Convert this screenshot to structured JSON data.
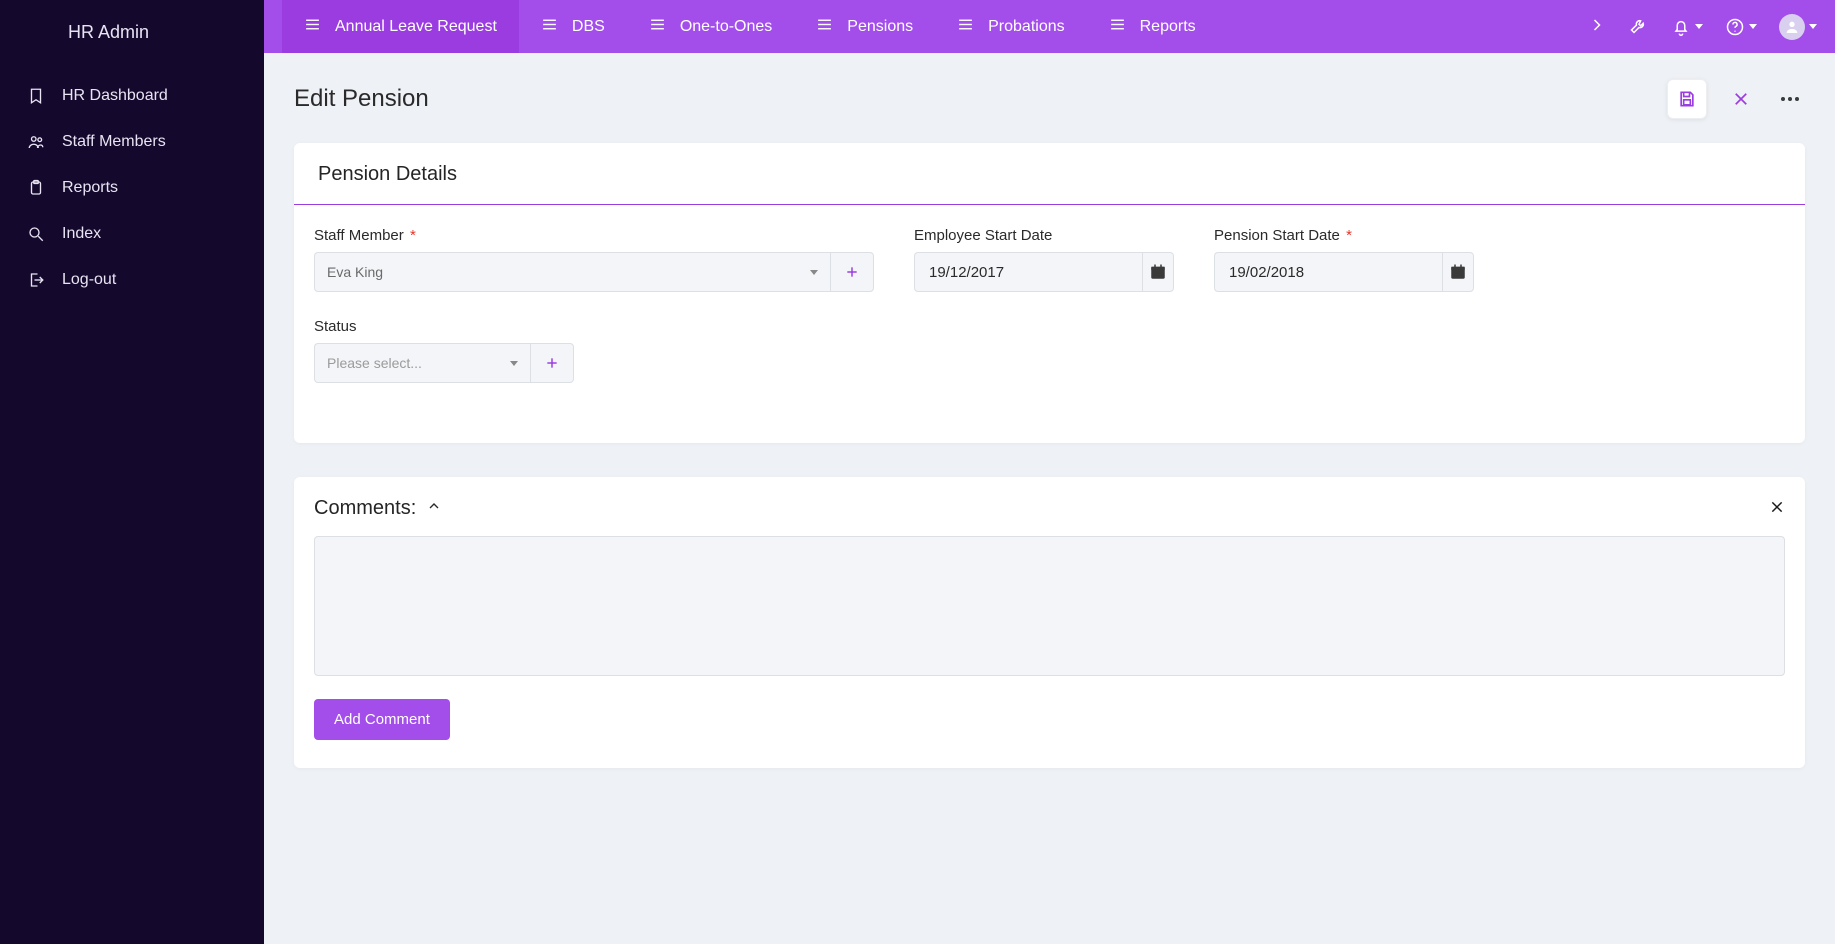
{
  "app": {
    "title": "HR Admin"
  },
  "sidebar": {
    "items": [
      {
        "label": "HR Dashboard",
        "icon": "bookmark-icon"
      },
      {
        "label": "Staff Members",
        "icon": "people-icon"
      },
      {
        "label": "Reports",
        "icon": "clipboard-icon"
      },
      {
        "label": "Index",
        "icon": "search-icon"
      },
      {
        "label": "Log-out",
        "icon": "logout-icon"
      }
    ]
  },
  "topTabs": [
    {
      "label": "Annual Leave Request"
    },
    {
      "label": "DBS"
    },
    {
      "label": "One-to-Ones"
    },
    {
      "label": "Pensions"
    },
    {
      "label": "Probations"
    },
    {
      "label": "Reports"
    }
  ],
  "page": {
    "title": "Edit Pension",
    "card_title": "Pension Details",
    "fields": {
      "staff_member": {
        "label": "Staff Member",
        "value": "Eva King",
        "required": true
      },
      "employee_start_date": {
        "label": "Employee Start Date",
        "value": "19/12/2017",
        "required": false
      },
      "pension_start_date": {
        "label": "Pension Start Date",
        "value": "19/02/2018",
        "required": true
      },
      "status": {
        "label": "Status",
        "placeholder": "Please select...",
        "required": false
      }
    }
  },
  "comments": {
    "title": "Comments:",
    "add_label": "Add Comment",
    "value": ""
  }
}
